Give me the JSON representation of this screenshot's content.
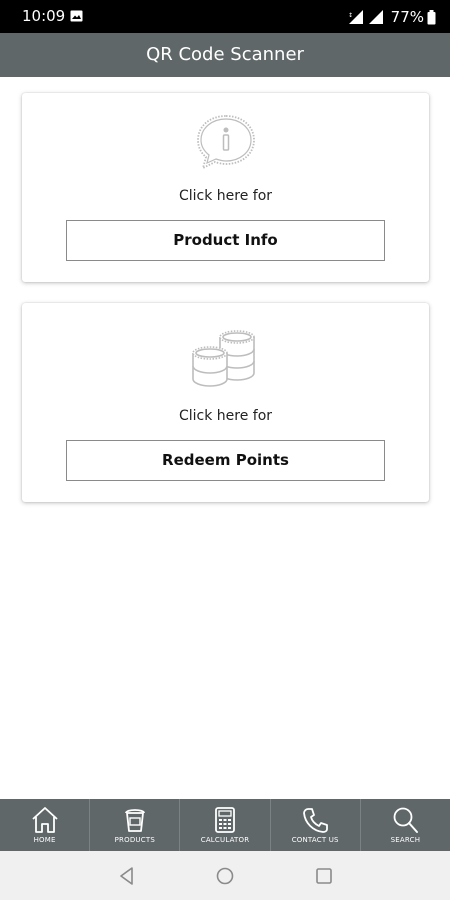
{
  "status_bar": {
    "time": "10:09",
    "battery": "77%",
    "icons": [
      "gallery-icon",
      "data-icon",
      "signal-icon",
      "battery-icon"
    ]
  },
  "header": {
    "title": "QR Code Scanner"
  },
  "cards": [
    {
      "icon": "info-bubble-icon",
      "caption": "Click here for",
      "button_label": "Product Info"
    },
    {
      "icon": "coins-icon",
      "caption": "Click here for",
      "button_label": "Redeem Points"
    }
  ],
  "bottom_nav": {
    "items": [
      {
        "label": "HOME",
        "icon": "home-icon"
      },
      {
        "label": "PRODUCTS",
        "icon": "paint-bucket-icon"
      },
      {
        "label": "CALCULATOR",
        "icon": "calculator-icon"
      },
      {
        "label": "CONTACT US",
        "icon": "phone-icon"
      },
      {
        "label": "SEARCH",
        "icon": "search-icon"
      }
    ]
  },
  "system_nav": {
    "icons": [
      "back-icon",
      "home-circle-icon",
      "recents-icon"
    ]
  },
  "colors": {
    "app_bar": "#5f6769",
    "status_bar": "#000000",
    "background": "#ffffff",
    "icon_grey": "#bdbdbd"
  }
}
